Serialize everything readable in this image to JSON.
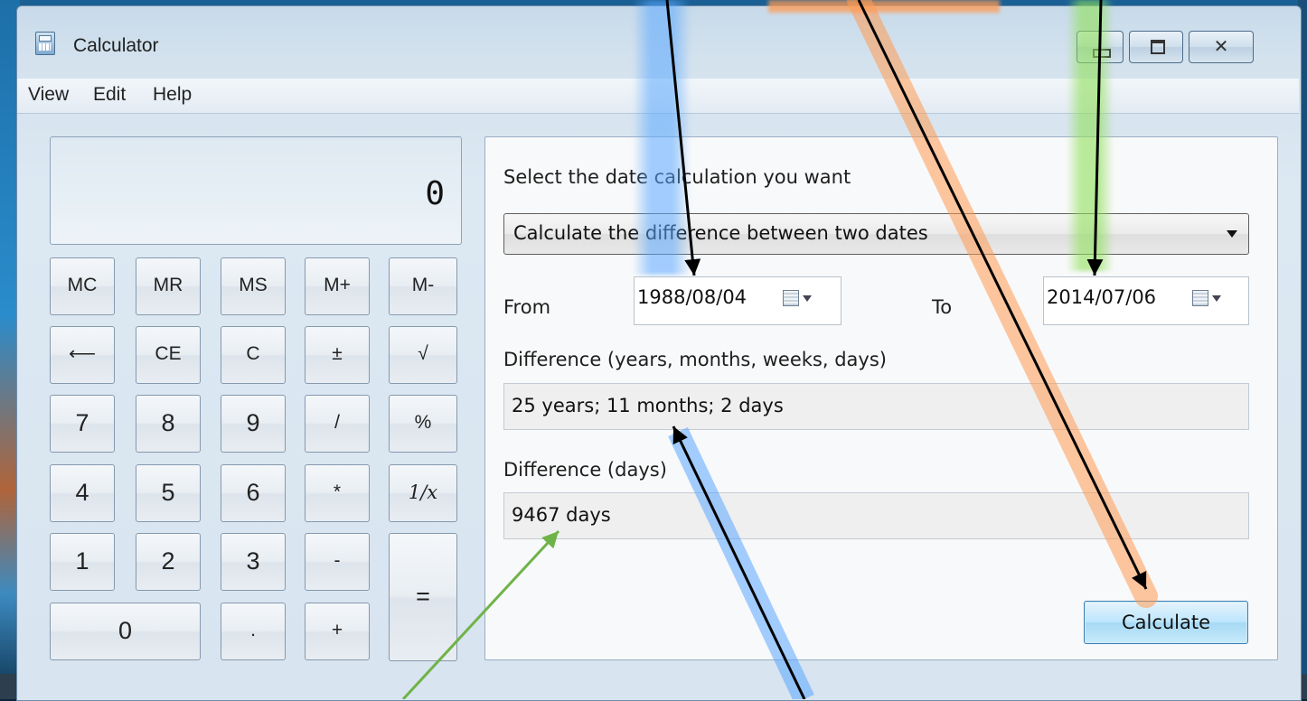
{
  "window": {
    "title": "Calculator",
    "controls": {
      "minimize": "minimize",
      "maximize": "maximize",
      "close": "close"
    }
  },
  "menu": {
    "items": [
      "View",
      "Edit",
      "Help"
    ]
  },
  "display": {
    "value": "0"
  },
  "keypad": {
    "rows": [
      [
        "MC",
        "MR",
        "MS",
        "M+",
        "M-"
      ],
      [
        "⟵",
        "CE",
        "C",
        "±",
        "√"
      ],
      [
        "7",
        "8",
        "9",
        "/",
        "%"
      ],
      [
        "4",
        "5",
        "6",
        "*",
        "1/x"
      ],
      [
        "1",
        "2",
        "3",
        "-",
        "="
      ],
      [
        "0",
        ".",
        "+"
      ]
    ]
  },
  "date_panel": {
    "prompt": "Select the date calculation you want",
    "mode": "Calculate the difference between two dates",
    "from_label": "From",
    "from_value": "1988/08/04",
    "to_label": "To",
    "to_value": "2014/07/06",
    "diff_label": "Difference (years, months, weeks, days)",
    "diff_value": "25 years; 11 months; 2 days",
    "days_label": "Difference (days)",
    "days_value": "9467 days",
    "calculate_label": "Calculate"
  },
  "annotations": {
    "highlight_colors": {
      "blue": "#5aa8ff",
      "orange": "#ff9a52",
      "green": "#8fe05a"
    },
    "arrow_colors": {
      "black": "#000000",
      "green": "#6fb348"
    }
  }
}
